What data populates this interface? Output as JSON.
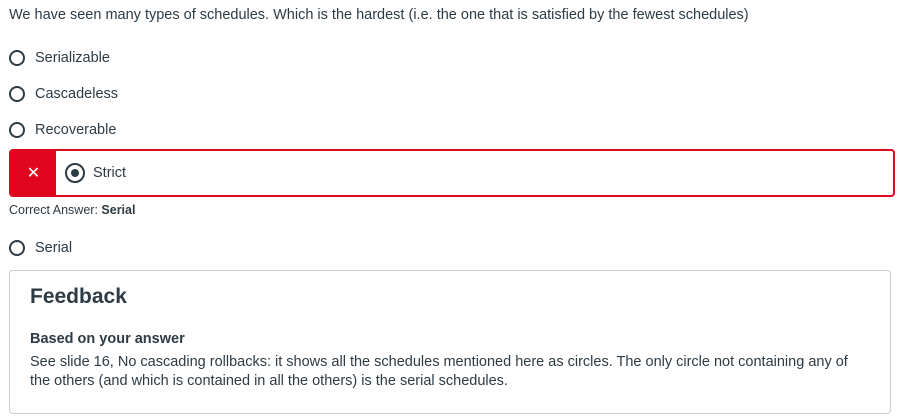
{
  "question": "We have seen many types of schedules. Which is the hardest (i.e. the one that is satisfied by the fewest schedules)",
  "options": [
    {
      "label": "Serializable",
      "checked": false
    },
    {
      "label": "Cascadeless",
      "checked": false
    },
    {
      "label": "Recoverable",
      "checked": false
    },
    {
      "label": "Strict",
      "checked": true,
      "status": "incorrect"
    },
    {
      "label": "Serial",
      "checked": false
    }
  ],
  "incorrect_marker": "✕",
  "correct_answer": {
    "prefix": "Correct Answer:",
    "value": "Serial"
  },
  "feedback": {
    "title": "Feedback",
    "subtitle": "Based on your answer",
    "text": "See slide 16, No cascading rollbacks: it shows all the schedules mentioned here as circles. The only circle not containing any of the others (and which is contained in all the others) is the serial schedules."
  },
  "colors": {
    "text": "#2d3b45",
    "incorrect": "#e0061f",
    "border": "#c7cdd1"
  }
}
